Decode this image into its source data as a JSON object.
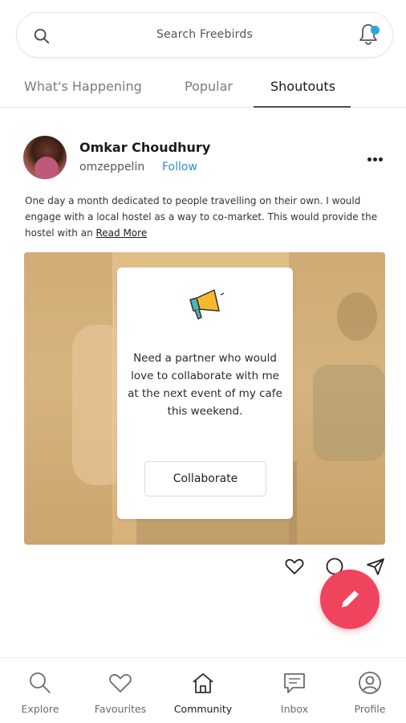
{
  "search": {
    "placeholder": "Search Freebirds",
    "has_notification": true,
    "notification_color": "#2aa6e0"
  },
  "tabs": [
    {
      "label": "What's Happening",
      "active": false
    },
    {
      "label": "Popular",
      "active": false
    },
    {
      "label": "Shoutouts",
      "active": true
    }
  ],
  "post": {
    "author_name": "Omkar Choudhury",
    "author_handle": "omzeppelin",
    "follow_label": "Follow",
    "body": "One day a month dedicated to people travelling on their own. I would engage with a local hostel as a way to co-market. This would provide the hostel with an ",
    "read_more_label": "Read More",
    "card": {
      "icon": "megaphone-icon",
      "text": "Need a partner who would love to collaborate with me at the next event of my cafe this weekend.",
      "button_label": "Collaborate"
    }
  },
  "actions": [
    "heart-icon",
    "comment-icon",
    "send-icon"
  ],
  "fab": {
    "icon": "pencil-icon",
    "color": "#f0445e"
  },
  "bottom_nav": [
    {
      "label": "Explore",
      "icon": "search-icon",
      "active": false
    },
    {
      "label": "Favourites",
      "icon": "heart-icon",
      "active": false
    },
    {
      "label": "Community",
      "icon": "home-icon",
      "active": true
    },
    {
      "label": "Inbox",
      "icon": "chat-icon",
      "active": false
    },
    {
      "label": "Profile",
      "icon": "user-icon",
      "active": false
    }
  ],
  "colors": {
    "accent_link": "#2a8fd4",
    "tab_active": "#1a1a1a",
    "tab_inactive": "#7b7b7b"
  }
}
